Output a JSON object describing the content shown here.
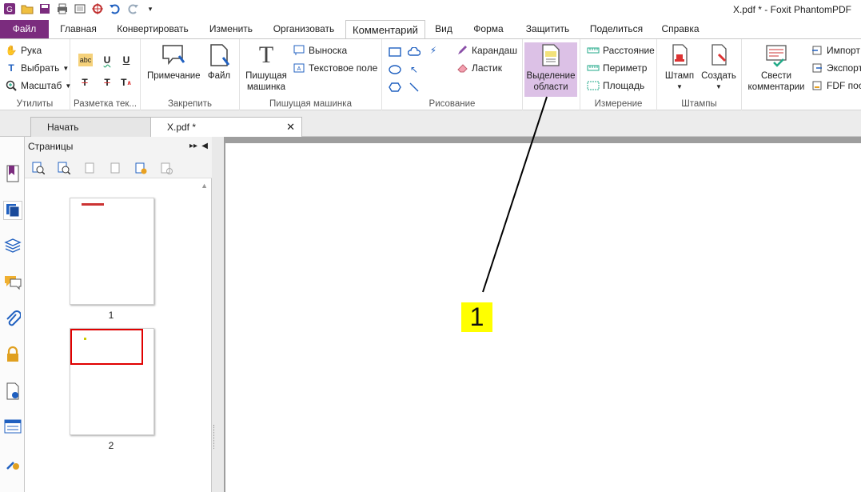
{
  "window": {
    "title": "X.pdf * - Foxit PhantomPDF"
  },
  "ribbon_tabs": [
    {
      "label": "Файл"
    },
    {
      "label": "Главная"
    },
    {
      "label": "Конвертировать"
    },
    {
      "label": "Изменить"
    },
    {
      "label": "Организовать"
    },
    {
      "label": "Комментарий"
    },
    {
      "label": "Вид"
    },
    {
      "label": "Форма"
    },
    {
      "label": "Защитить"
    },
    {
      "label": "Поделиться"
    },
    {
      "label": "Справка"
    }
  ],
  "groups": {
    "utilities": {
      "label": "Утилиты",
      "hand": "Рука",
      "select": "Выбрать",
      "zoom": "Масштаб"
    },
    "markup": {
      "label": "Разметка тек..."
    },
    "pin": {
      "label": "Закрепить",
      "note": "Примечание",
      "file": "Файл"
    },
    "typewriter": {
      "label": "Пишущая машинка",
      "typewriter_btn": "Пишущая машинка",
      "callout": "Выноска",
      "textbox": "Текстовое поле"
    },
    "drawing": {
      "label": "Рисование",
      "pencil": "Карандаш",
      "eraser": "Ластик"
    },
    "area": {
      "highlight": "Выделение области"
    },
    "measure": {
      "label": "Измерение",
      "distance": "Расстояние",
      "perimeter": "Периметр",
      "area": "Площадь"
    },
    "stamps": {
      "label": "Штампы",
      "stamp": "Штамп",
      "create": "Создать"
    },
    "manage": {
      "summarize": "Свести комментарии",
      "import": "Импорт",
      "export": "Экспорт",
      "fdf": "FDF поср"
    }
  },
  "doc_tabs": [
    {
      "label": "Начать"
    },
    {
      "label": "X.pdf *"
    }
  ],
  "pages_panel": {
    "title": "Страницы",
    "thumbs": [
      {
        "num": "1"
      },
      {
        "num": "2"
      }
    ]
  },
  "annotation": {
    "label": "1"
  },
  "colors": {
    "file_tab": "#7b2c7e",
    "selected_btn": "#dcc1e6",
    "callout": "#ffff00",
    "thumb_highlight": "#e00000"
  }
}
